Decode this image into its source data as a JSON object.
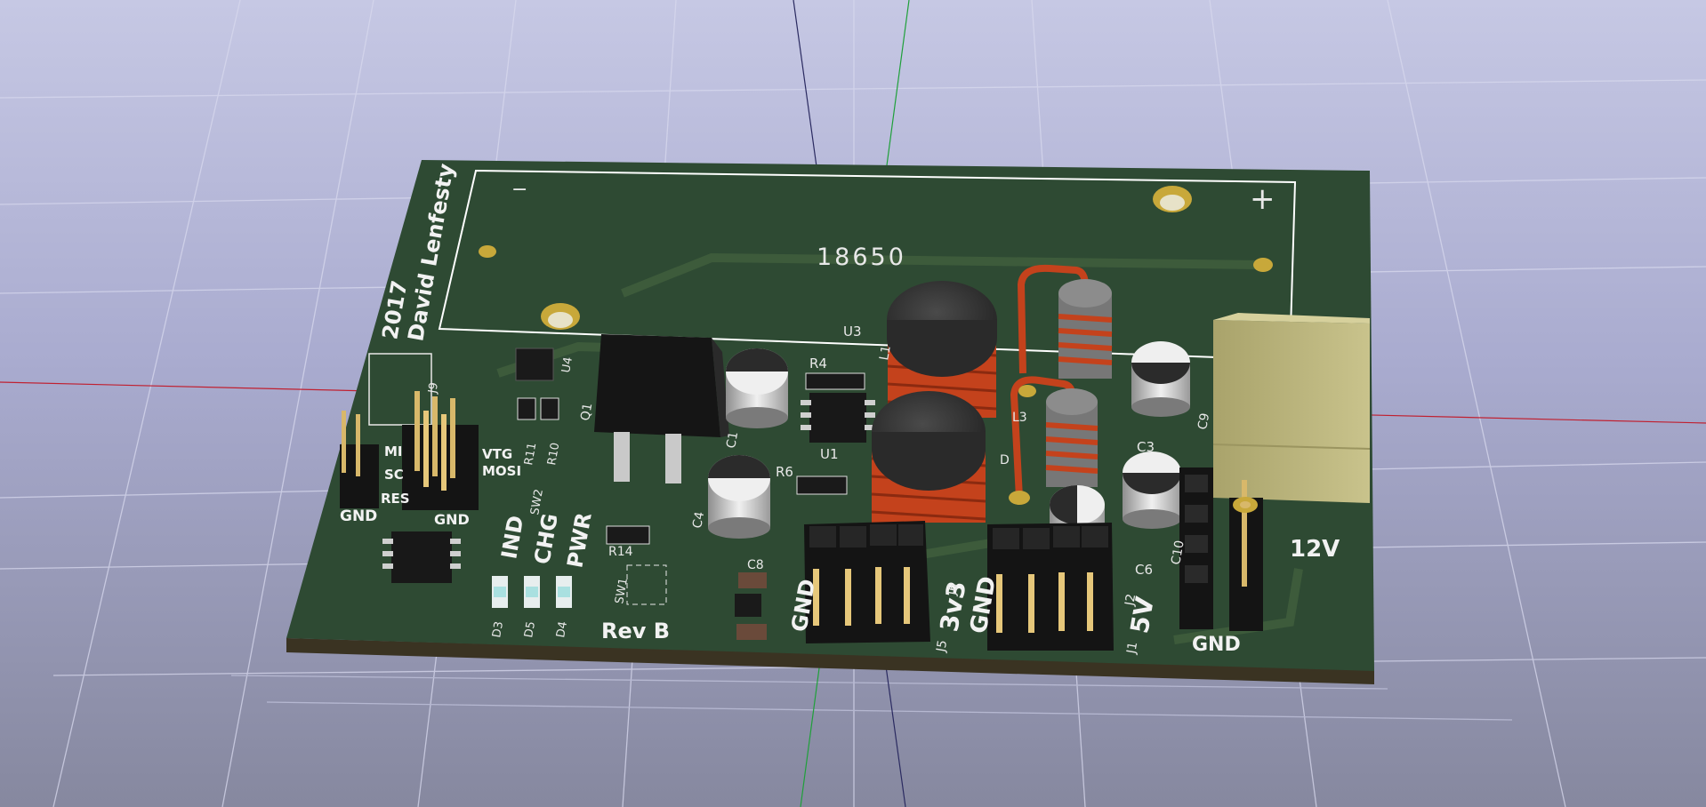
{
  "board": {
    "author_year": "2017",
    "author_name": "David Lenfesty",
    "battery_label": "18650",
    "battery_minus": "−",
    "battery_plus": "+",
    "revision": "Rev B",
    "voltage_12v": "12V",
    "label_5v": "5V",
    "label_3v3": "3v3",
    "label_gnd": "GND",
    "isp_labels": [
      "MI",
      "SC",
      "RES",
      "VTG",
      "MOSI"
    ],
    "led_labels": [
      "IND",
      "CHG",
      "PWR"
    ],
    "refdes": [
      "U3",
      "R4",
      "U1",
      "U4",
      "J9",
      "Q1",
      "C1",
      "R11",
      "R10",
      "SW2",
      "R6",
      "C4",
      "R14",
      "SW1",
      "C8",
      "J6",
      "J5",
      "L1",
      "C3",
      "C6",
      "C10",
      "J2",
      "J1",
      "C9",
      "D3",
      "D5",
      "D4",
      "L3",
      "D"
    ]
  },
  "colors": {
    "pcb": "#2e4a33",
    "pcb_edge": "#3a3322",
    "silkscreen": "#f2f2f2",
    "copper_pad": "#c8a83a",
    "coil": "#c4421c",
    "connector": "#141414",
    "terminal_block": "#b6b07a"
  }
}
